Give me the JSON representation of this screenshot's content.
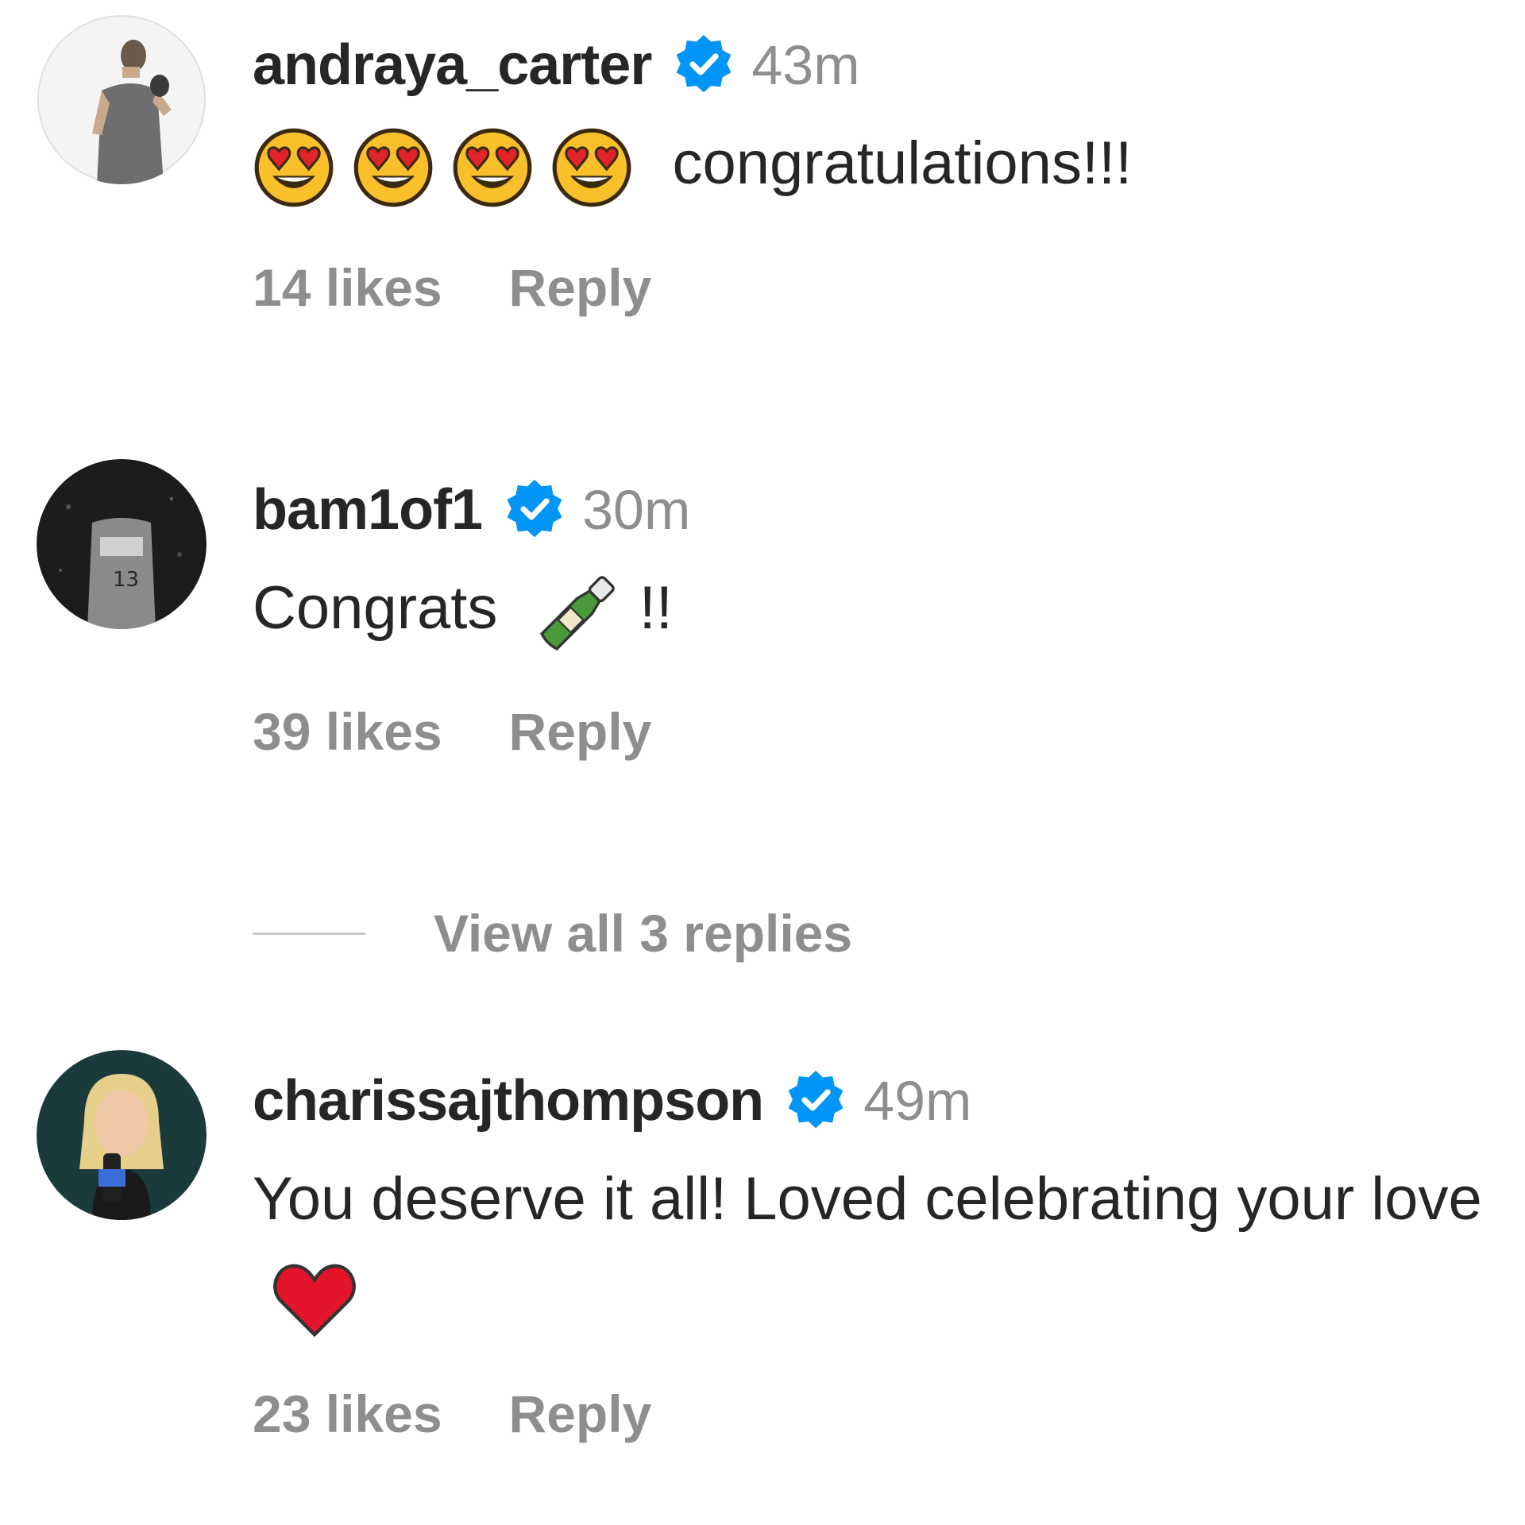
{
  "comments": [
    {
      "username": "andraya_carter",
      "verified": true,
      "time": "43m",
      "text": "congratulations!!!",
      "emoji_prefix": [
        "heart-eyes",
        "heart-eyes",
        "heart-eyes",
        "heart-eyes"
      ],
      "likes": "14 likes",
      "reply_label": "Reply"
    },
    {
      "username": "bam1of1",
      "verified": true,
      "time": "30m",
      "text_before": "Congrats",
      "text_emoji": "champagne-bottle",
      "text_after": "!!",
      "likes": "39 likes",
      "reply_label": "Reply"
    },
    {
      "username": "charissajthompson",
      "verified": true,
      "time": "49m",
      "text": "You deserve it all! Loved celebrating your love",
      "text_emoji": "red-heart",
      "likes": "23 likes",
      "reply_label": "Reply"
    }
  ],
  "view_replies_label": "View all 3 replies",
  "colors": {
    "text": "#262626",
    "secondary": "#8e8e8e",
    "verified": "#0095f6"
  }
}
